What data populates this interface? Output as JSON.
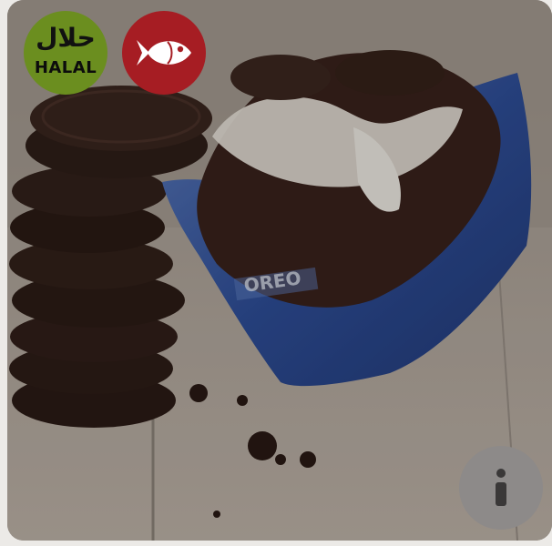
{
  "badges": {
    "halal": {
      "arabic_text": "حلال",
      "latin_text": "HALAL",
      "color": "#6b8e1f",
      "icon": "halal-icon"
    },
    "fish": {
      "icon": "fish-icon",
      "color": "#a61d23"
    }
  },
  "photo": {
    "subject": "product-photo",
    "wrapper_text": "OREO",
    "colors": {
      "wrapper": "#2f4f9a",
      "chocolate": "#3a221c",
      "cream": "#e9e4da",
      "table": "#b9aea2"
    }
  },
  "info_button": {
    "icon": "info-icon",
    "label": "i",
    "color": "#8d8a89"
  }
}
